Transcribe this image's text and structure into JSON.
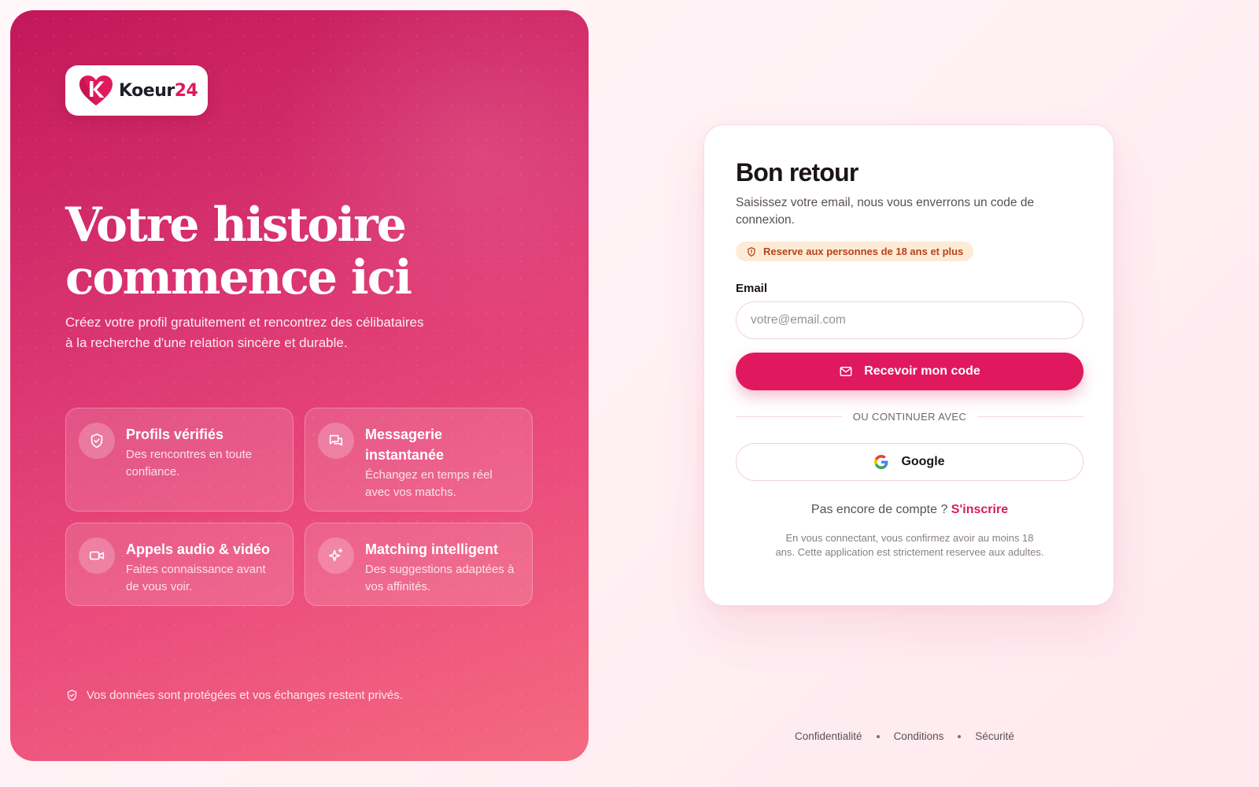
{
  "brand": {
    "name_main": "Koeur",
    "name_num": "24",
    "colors": {
      "primary": "#e0195e",
      "hero_start": "#c2185b",
      "hero_end": "#f56a80"
    }
  },
  "hero": {
    "title_line1": "Votre histoire",
    "title_line2": "commence ici",
    "subtitle": "Créez votre profil gratuitement et rencontrez des célibataires à la recherche d'une relation sincère et durable.",
    "features": [
      {
        "icon": "shield-check-icon",
        "title": "Profils vérifiés",
        "desc": "Des rencontres en toute confiance."
      },
      {
        "icon": "chat-bubbles-icon",
        "title": "Messagerie instantanée",
        "desc": "Échangez en temps réel avec vos matchs."
      },
      {
        "icon": "video-camera-icon",
        "title": "Appels audio & vidéo",
        "desc": "Faites connaissance avant de vous voir."
      },
      {
        "icon": "sparkles-icon",
        "title": "Matching intelligent",
        "desc": "Des suggestions adaptées à vos affinités."
      }
    ],
    "privacy_note": "Vos données sont protégées et vos échanges restent privés."
  },
  "login": {
    "title": "Bon retour",
    "subtitle": "Saisissez votre email, nous vous enverrons un code de connexion.",
    "age_badge": "Reserve aux personnes de 18 ans et plus",
    "email_label": "Email",
    "email_placeholder": "votre@email.com",
    "email_value": "",
    "submit_label": "Recevoir mon code",
    "divider_label": "OU CONTINUER AVEC",
    "google_label": "Google",
    "signup_prompt": "Pas encore de compte ?",
    "signup_link": "S'inscrire",
    "legal": "En vous connectant, vous confirmez avoir au moins 18 ans. Cette application est strictement reservee aux adultes."
  },
  "footer": {
    "links": [
      "Confidentialité",
      "Conditions",
      "Sécurité"
    ]
  }
}
